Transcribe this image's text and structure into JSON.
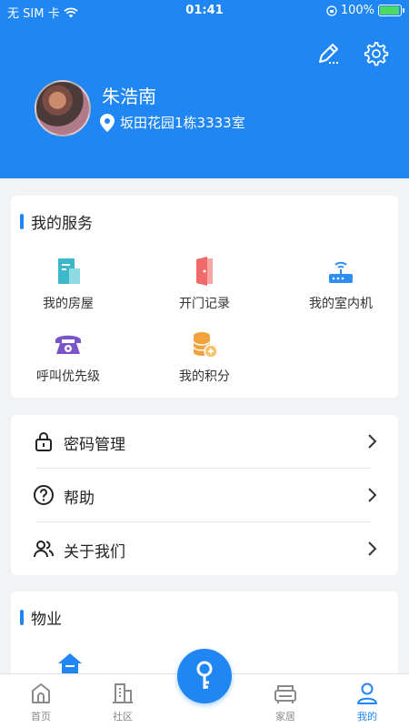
{
  "status_bar": {
    "carrier": "无 SIM 卡",
    "time": "01:41",
    "battery": "100%",
    "battery_level": 1.0
  },
  "header": {
    "edit_icon": "pencil-icon",
    "settings_icon": "gear-icon",
    "username": "朱浩南",
    "address": "坂田花园1栋3333室"
  },
  "services": {
    "title": "我的服务",
    "items": [
      {
        "label": "我的房屋",
        "icon": "building-icon",
        "color": "#3cb8c9"
      },
      {
        "label": "开门记录",
        "icon": "door-icon",
        "color": "#f06a6a"
      },
      {
        "label": "我的室内机",
        "icon": "router-icon",
        "color": "#2f8ef4"
      },
      {
        "label": "呼叫优先级",
        "icon": "telephone-icon",
        "color": "#7a55c8"
      },
      {
        "label": "我的积分",
        "icon": "coins-icon",
        "color": "#f2a23a"
      }
    ]
  },
  "settings_list": [
    {
      "label": "密码管理",
      "icon": "lock-icon"
    },
    {
      "label": "帮助",
      "icon": "help-icon"
    },
    {
      "label": "关于我们",
      "icon": "users-icon"
    }
  ],
  "property": {
    "title": "物业",
    "first_icon": "house-icon"
  },
  "tabbar": {
    "tabs": [
      {
        "label": "首页",
        "icon": "home-icon"
      },
      {
        "label": "社区",
        "icon": "buildings-icon"
      },
      {
        "label": "家居",
        "icon": "sofa-icon"
      },
      {
        "label": "我的",
        "icon": "person-icon"
      }
    ],
    "center_icon": "key-icon",
    "active_color": "#1f86f3",
    "accent": "#1f86f3"
  }
}
